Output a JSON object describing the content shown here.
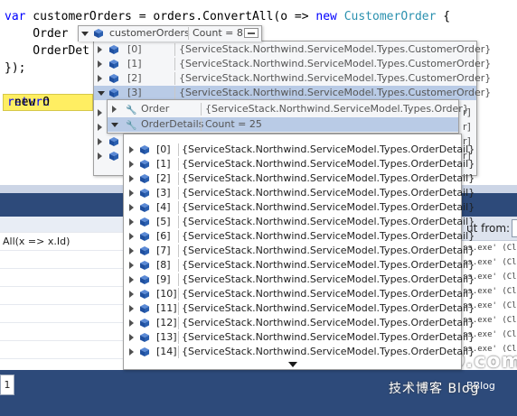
{
  "code": {
    "line1": {
      "kw": "var",
      "pre": " customerOrders = orders.ConvertAll(o => ",
      "new": "new",
      "type": " CustomerOrder",
      "post": " {"
    },
    "line2": "    Order",
    "line3": "    OrderDet",
    "line4": "});",
    "current_line": {
      "kw": "return",
      "rest": " new O"
    }
  },
  "tip1": {
    "header": {
      "name": "customerOrders",
      "value": "Count = 8"
    },
    "items": [
      {
        "index": "[0]",
        "value": "{ServiceStack.Northwind.ServiceModel.Types.CustomerOrder}"
      },
      {
        "index": "[1]",
        "value": "{ServiceStack.Northwind.ServiceModel.Types.CustomerOrder}"
      },
      {
        "index": "[2]",
        "value": "{ServiceStack.Northwind.ServiceModel.Types.CustomerOrder}"
      },
      {
        "index": "[3]",
        "value": "{ServiceStack.Northwind.ServiceModel.Types.CustomerOrder}"
      }
    ],
    "hidden_rows": [
      {
        "edge": "r]"
      },
      {
        "edge": "r]"
      },
      {
        "edge": "r]"
      },
      {
        "edge": "r]"
      }
    ]
  },
  "tip2": {
    "order": {
      "name": "Order",
      "value": "{ServiceStack.Northwind.ServiceModel.Types.Order}"
    },
    "details": {
      "name": "OrderDetails",
      "value": "Count = 25"
    }
  },
  "tip3": {
    "items": [
      {
        "index": "[0]",
        "value": "{ServiceStack.Northwind.ServiceModel.Types.OrderDetail}"
      },
      {
        "index": "[1]",
        "value": "{ServiceStack.Northwind.ServiceModel.Types.OrderDetail}"
      },
      {
        "index": "[2]",
        "value": "{ServiceStack.Northwind.ServiceModel.Types.OrderDetail}"
      },
      {
        "index": "[3]",
        "value": "{ServiceStack.Northwind.ServiceModel.Types.OrderDetail}"
      },
      {
        "index": "[4]",
        "value": "{ServiceStack.Northwind.ServiceModel.Types.OrderDetail}"
      },
      {
        "index": "[5]",
        "value": "{ServiceStack.Northwind.ServiceModel.Types.OrderDetail}"
      },
      {
        "index": "[6]",
        "value": "{ServiceStack.Northwind.ServiceModel.Types.OrderDetail}"
      },
      {
        "index": "[7]",
        "value": "{ServiceStack.Northwind.ServiceModel.Types.OrderDetail}"
      },
      {
        "index": "[8]",
        "value": "{ServiceStack.Northwind.ServiceModel.Types.OrderDetail}"
      },
      {
        "index": "[9]",
        "value": "{ServiceStack.Northwind.ServiceModel.Types.OrderDetail}"
      },
      {
        "index": "[10]",
        "value": "{ServiceStack.Northwind.ServiceModel.Types.OrderDetail}"
      },
      {
        "index": "[11]",
        "value": "{ServiceStack.Northwind.ServiceModel.Types.OrderDetail}"
      },
      {
        "index": "[12]",
        "value": "{ServiceStack.Northwind.ServiceModel.Types.OrderDetail}"
      },
      {
        "index": "[13]",
        "value": "{ServiceStack.Northwind.ServiceModel.Types.OrderDetail}"
      },
      {
        "index": "[14]",
        "value": "{ServiceStack.Northwind.ServiceModel.Types.OrderDetail}"
      }
    ]
  },
  "left_panel": {
    "row1": "All(x => x.Id)"
  },
  "output": {
    "label": "ut from:",
    "lines": [
      "ss.exe' (Cl",
      "ss.exe' (Cl",
      "ss.exe' (Cl",
      "ss.exe' (Cl",
      "ss.exe' (Cl",
      "ss.exe' (Cl",
      "ss.exe' (Cl",
      "ss.exe' (Cl"
    ]
  },
  "statusbar": {
    "tab": "1",
    "right": "BBlog"
  },
  "watermark": {
    "big": "51CTO.com",
    "small": "技术博客  Blog"
  },
  "colors": {
    "cube": "#2a5fb0",
    "selected_row": "#b9cbe6",
    "panel": "#2d4a7a",
    "current_line": "#ffee62"
  }
}
